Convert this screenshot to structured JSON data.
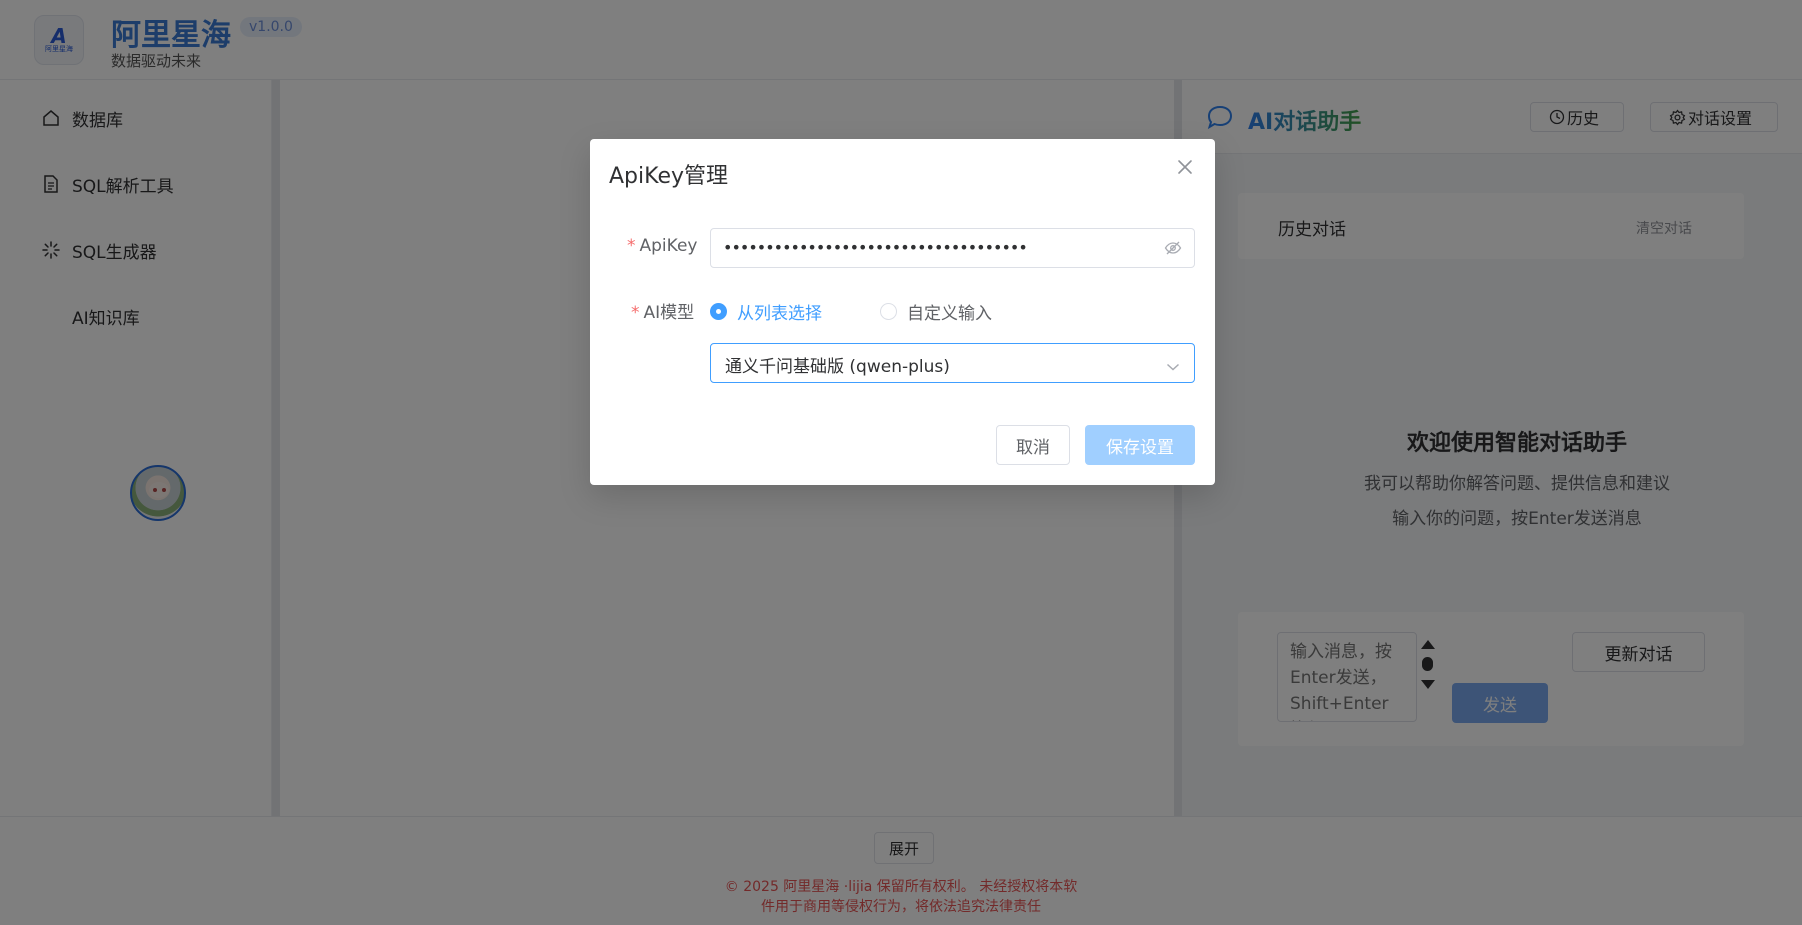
{
  "header": {
    "logo_text": "阿里星海",
    "app_title": "阿里星海",
    "version": "v1.0.0",
    "slogan": "数据驱动未来"
  },
  "sidebar": {
    "items": [
      {
        "label": "数据库",
        "icon": "home-icon"
      },
      {
        "label": "SQL解析工具",
        "icon": "document-icon"
      },
      {
        "label": "SQL生成器",
        "icon": "loading-icon"
      },
      {
        "label": "AI知识库",
        "icon": ""
      }
    ]
  },
  "chat": {
    "title": "AI对话助手",
    "history_button": "历史",
    "settings_button": "对话设置",
    "history_label": "历史对话",
    "clear_button": "清空对话",
    "welcome_title": "欢迎使用智能对话助手",
    "welcome_line1": "我可以帮助你解答问题、提供信息和建议",
    "welcome_line2": "输入你的问题，按Enter发送消息",
    "input_placeholder": "输入消息，按Enter发送，Shift+Enter换行",
    "send_button": "发送",
    "refresh_button": "更新对话"
  },
  "footer": {
    "expand_button": "展开",
    "copyright_line1": "© 2025 阿里星海 ·lijia 保留所有权利。 未经授权将本软",
    "copyright_line2": "件用于商用等侵权行为，将依法追究法律责任"
  },
  "dialog": {
    "title": "ApiKey管理",
    "apikey_label": "ApiKey",
    "apikey_value": "••••••••••••••••••••••••••••••••••••",
    "model_label": "AI模型",
    "radio_list": "从列表选择",
    "radio_custom": "自定义输入",
    "selected_model": "通义千问基础版 (qwen-plus)",
    "cancel_button": "取消",
    "save_button": "保存设置"
  },
  "colors": {
    "primary": "#409eff",
    "brand": "#3a7bd5",
    "danger": "#f56c6c",
    "overlay": "rgba(0,0,0,0.5)"
  }
}
